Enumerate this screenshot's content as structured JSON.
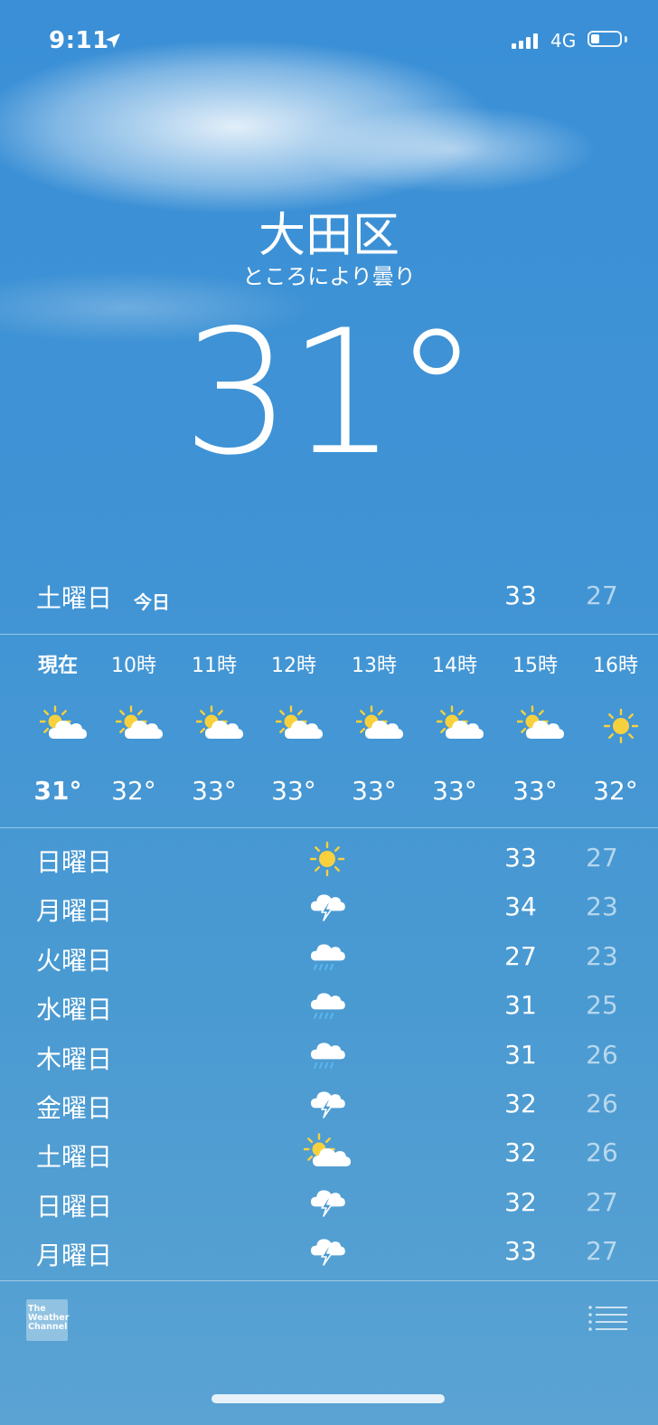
{
  "status_bar": {
    "time": "9:11",
    "network": "4G",
    "signal_bars": 4,
    "battery_level": 0.3
  },
  "location": {
    "city": "大田区",
    "condition": "ところにより曇り",
    "current_temp": "31°"
  },
  "today": {
    "day": "土曜日",
    "label": "今日",
    "high": "33",
    "low": "27"
  },
  "hourly": [
    {
      "time": "現在",
      "icon": "partly-cloudy-icon",
      "temp": "31°",
      "bold": true
    },
    {
      "time": "10時",
      "icon": "partly-cloudy-icon",
      "temp": "32°"
    },
    {
      "time": "11時",
      "icon": "partly-cloudy-icon",
      "temp": "33°"
    },
    {
      "time": "12時",
      "icon": "partly-cloudy-icon",
      "temp": "33°"
    },
    {
      "time": "13時",
      "icon": "partly-cloudy-icon",
      "temp": "33°"
    },
    {
      "time": "14時",
      "icon": "partly-cloudy-icon",
      "temp": "33°"
    },
    {
      "time": "15時",
      "icon": "partly-cloudy-icon",
      "temp": "33°"
    },
    {
      "time": "16時",
      "icon": "sun-icon",
      "temp": "32°"
    }
  ],
  "daily": [
    {
      "day": "日曜日",
      "icon": "sun-icon",
      "high": "33",
      "low": "27"
    },
    {
      "day": "月曜日",
      "icon": "thunderstorm-icon",
      "high": "34",
      "low": "23"
    },
    {
      "day": "火曜日",
      "icon": "rain-icon",
      "high": "27",
      "low": "23"
    },
    {
      "day": "水曜日",
      "icon": "rain-icon",
      "high": "31",
      "low": "25"
    },
    {
      "day": "木曜日",
      "icon": "rain-icon",
      "high": "31",
      "low": "26"
    },
    {
      "day": "金曜日",
      "icon": "thunderstorm-icon",
      "high": "32",
      "low": "26"
    },
    {
      "day": "土曜日",
      "icon": "partly-cloudy-icon",
      "high": "32",
      "low": "26"
    },
    {
      "day": "日曜日",
      "icon": "thunderstorm-icon",
      "high": "32",
      "low": "27"
    },
    {
      "day": "月曜日",
      "icon": "thunderstorm-icon",
      "high": "33",
      "low": "27"
    }
  ],
  "footer": {
    "logo_lines": [
      "The",
      "Weather",
      "Channel"
    ]
  },
  "colors": {
    "sun": "#f7d13d",
    "rain": "#5ab8f0",
    "cloud": "#ffffff"
  }
}
